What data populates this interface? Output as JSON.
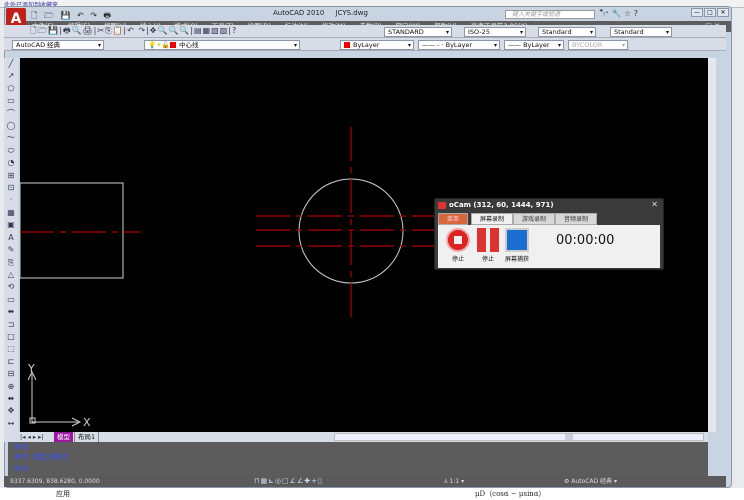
{
  "background": {
    "top_strip": "此处已添加到收藏夹",
    "below_left": "应用",
    "below_formula": "μD（cosα − μsinα）"
  },
  "window": {
    "app_button": "A",
    "title": "AutoCAD 2010",
    "filename": "JCYS.dwg",
    "search_placeholder": "键入关键字或短语",
    "qat_icons": [
      "new-icon",
      "open-icon",
      "save-icon",
      "undo-icon",
      "redo-icon",
      "plot-icon"
    ]
  },
  "menu": [
    "文件(F)",
    "编辑(E)",
    "视图(V)",
    "插入(I)",
    "格式(O)",
    "工具(T)",
    "绘图(D)",
    "标注(N)",
    "修改(M)",
    "参数(P)",
    "窗口(W)",
    "帮助(H)",
    "高考工具箱2.86(X)"
  ],
  "toolbar1": {
    "text_style": "STANDARD",
    "dim_style": "ISO-25",
    "table_style": "Standard",
    "multileader_style": "Standard"
  },
  "toolbar2": {
    "workspace": "AutoCAD 经典",
    "layer": "中心线",
    "color": "ByLayer",
    "linetype": "ByLayer",
    "lineweight": "ByLayer",
    "plotstyle": "BYCOLOR"
  },
  "colors": {
    "layer_red": "#ff0000",
    "centerline": "#b00000",
    "geometry": "#d0d0d0",
    "model_tab": "#9a18a0",
    "command_text": "#3b55ff"
  },
  "tabs": {
    "model": "模型",
    "layout": "布局1"
  },
  "command": {
    "lines": [
      "命令:",
      "命令: 指定对角点:",
      "命令:"
    ]
  },
  "status": {
    "coords": "9337.6309, 838.6280, 0.0000",
    "annotation_scale": "1:1",
    "workspace": "AutoCAD 经典"
  },
  "ucs": {
    "x": "X",
    "y": "Y"
  },
  "ocam": {
    "title": "oCam (312, 60, 1444, 971)",
    "tabs": [
      "菜单",
      "屏幕录制",
      "游戏录制",
      "音频录制"
    ],
    "buttons": [
      "停止",
      "停止",
      "屏幕捕获"
    ],
    "timer": "00:00:00"
  }
}
